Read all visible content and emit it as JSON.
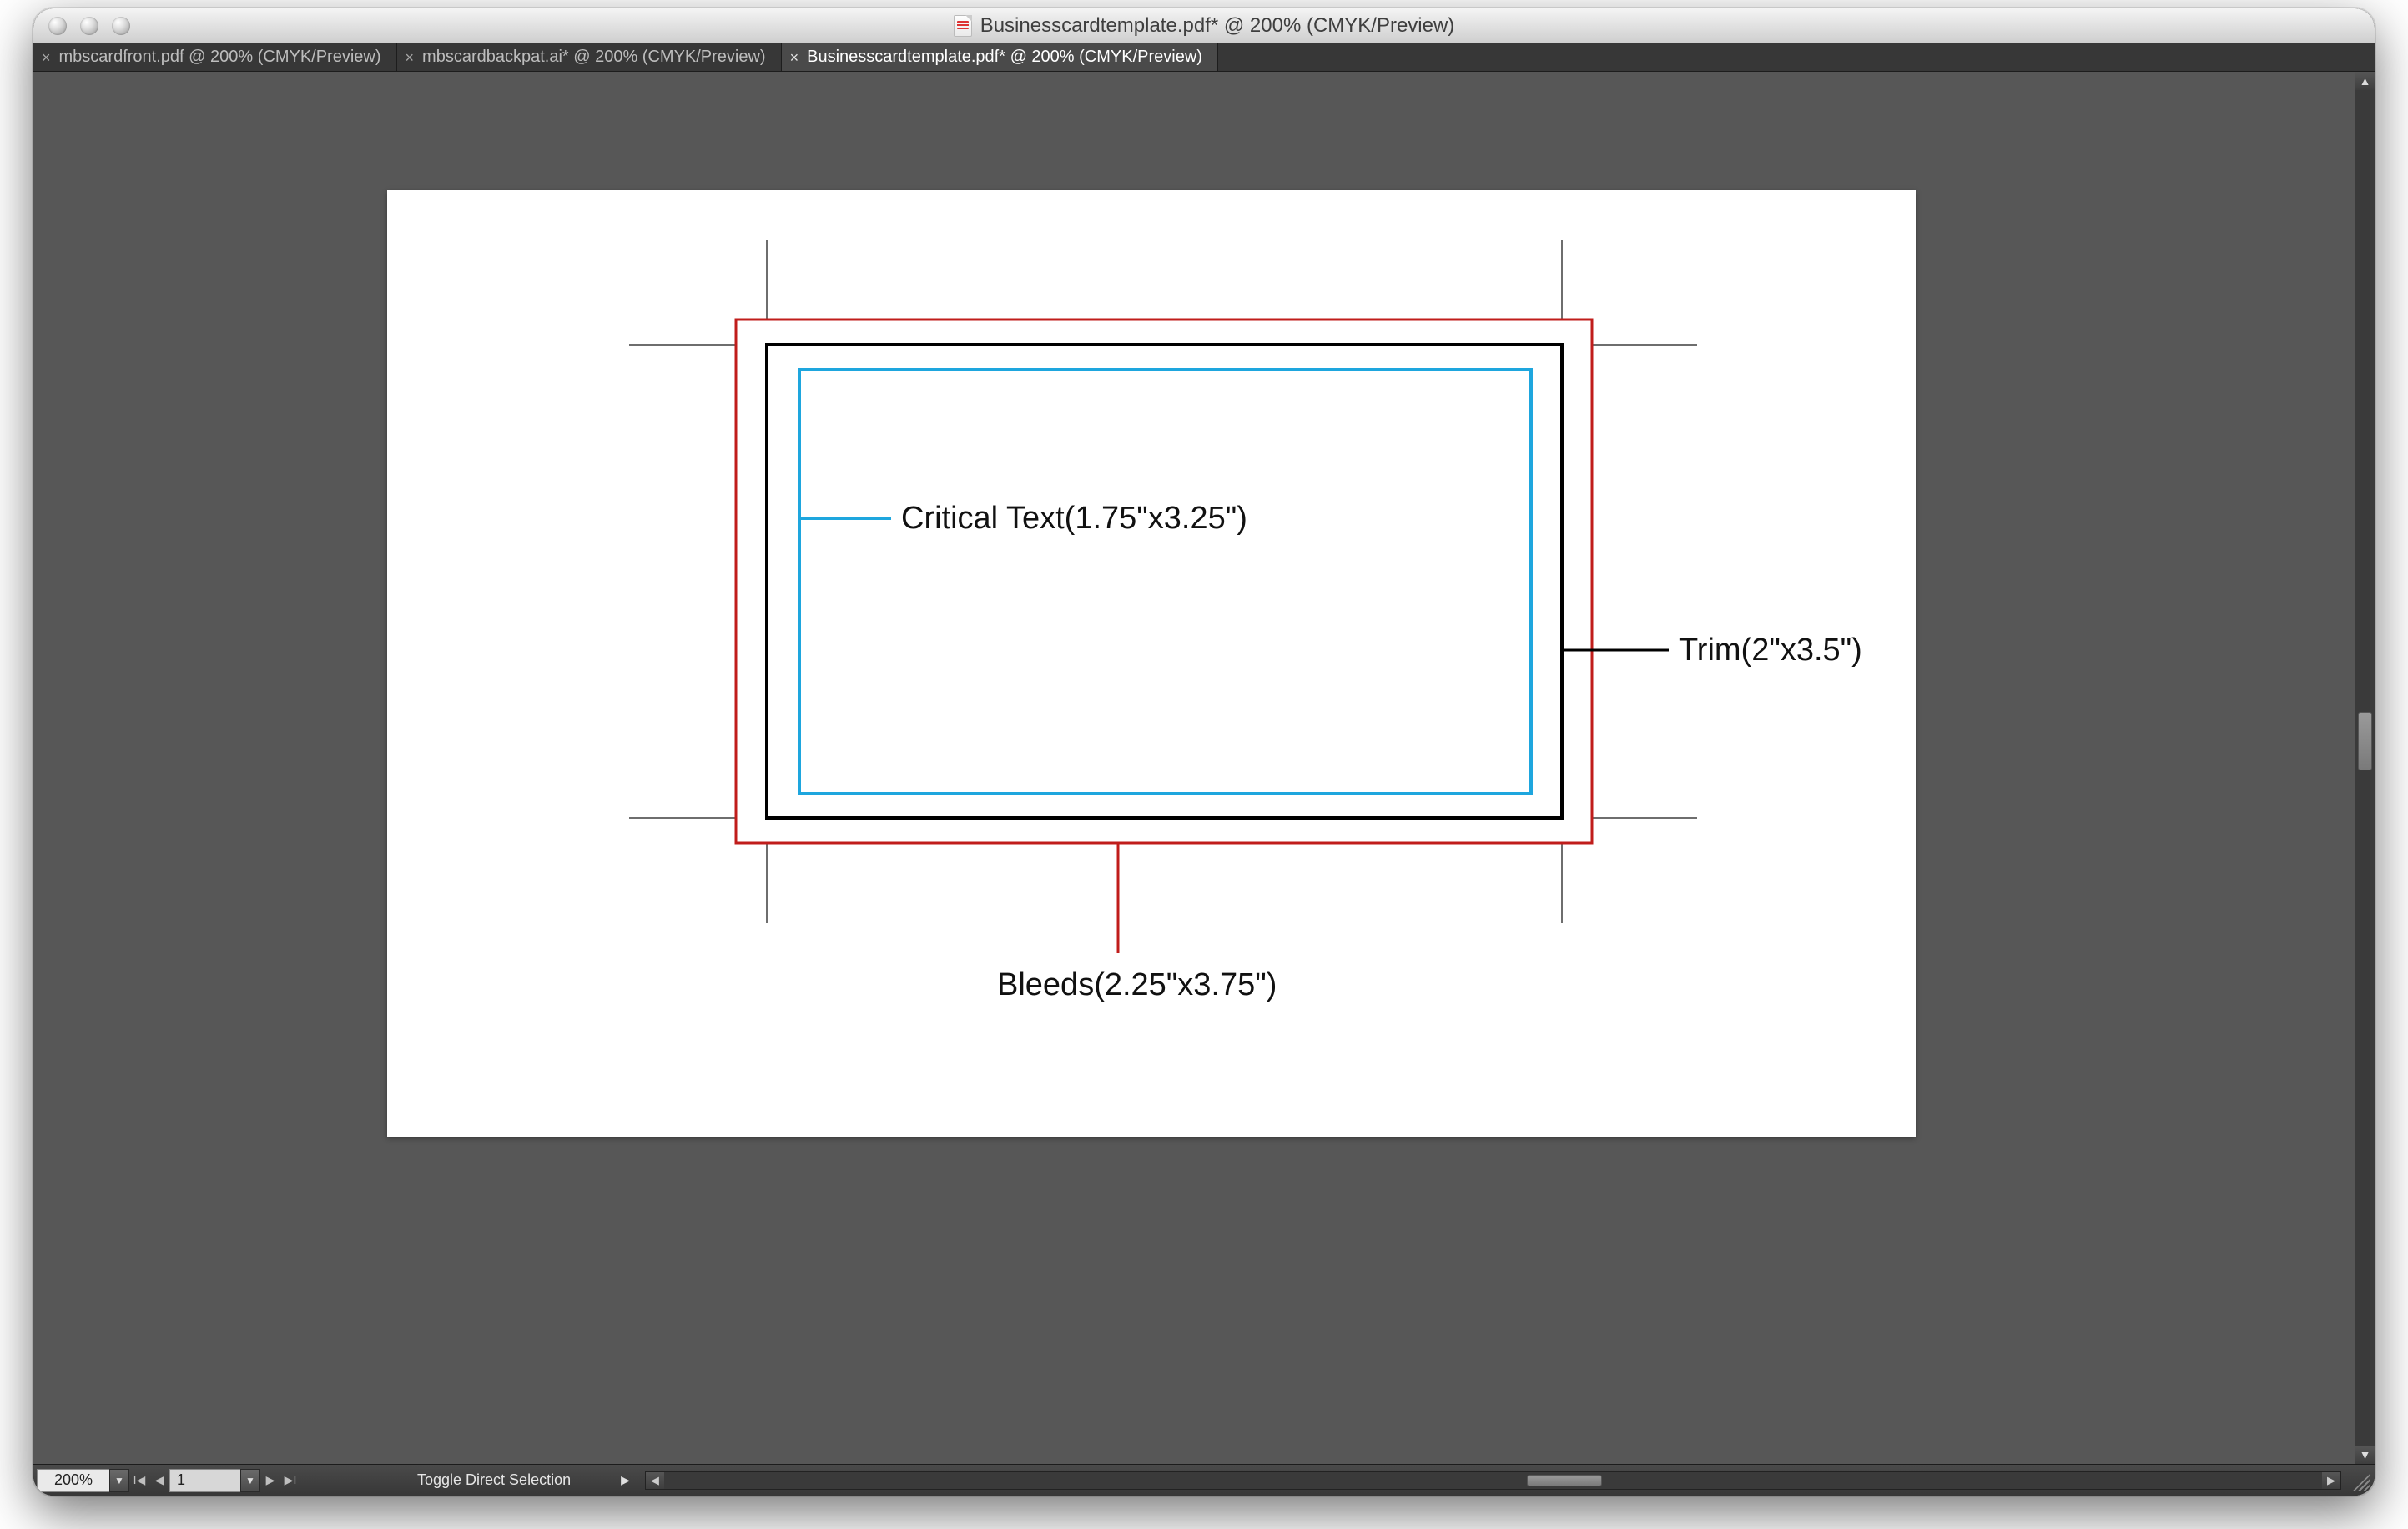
{
  "titlebar": {
    "title": "Businesscardtemplate.pdf* @ 200% (CMYK/Preview)"
  },
  "tabs": [
    {
      "label": "mbscardfront.pdf @ 200% (CMYK/Preview)",
      "active": false
    },
    {
      "label": "mbscardbackpat.ai* @ 200% (CMYK/Preview)",
      "active": false
    },
    {
      "label": "Businesscardtemplate.pdf* @ 200% (CMYK/Preview)",
      "active": true
    }
  ],
  "artwork": {
    "critical_label": "Critical Text(1.75\"x3.25\")",
    "trim_label": "Trim(2\"x3.5\")",
    "bleed_label": "Bleeds(2.25\"x3.75\")"
  },
  "status": {
    "zoom": "200%",
    "page": "1",
    "tool_hint": "Toggle Direct Selection"
  }
}
